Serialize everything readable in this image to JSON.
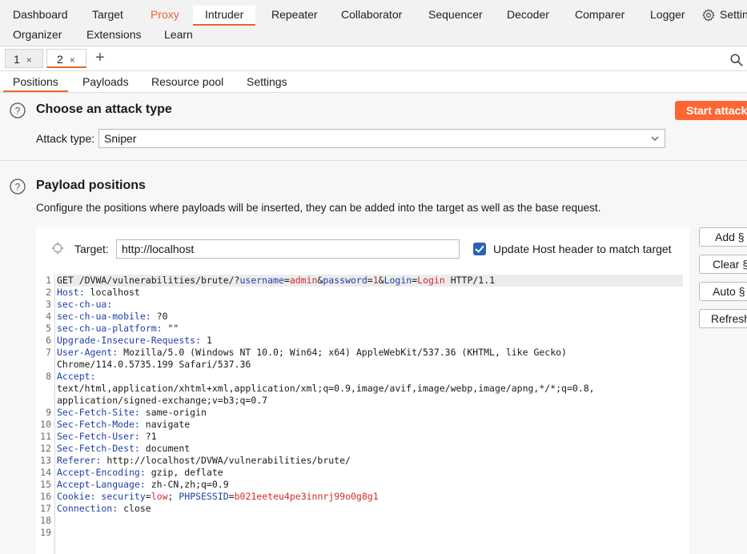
{
  "nav": {
    "items": [
      "Dashboard",
      "Target",
      "Proxy",
      "Intruder",
      "Repeater",
      "Collaborator",
      "Sequencer",
      "Decoder",
      "Comparer",
      "Logger",
      "Settings",
      "Organizer",
      "Extensions",
      "Learn"
    ],
    "settings_label": "Settings",
    "active": "Intruder"
  },
  "instance_tabs": [
    {
      "label": "1",
      "close": "×"
    },
    {
      "label": "2",
      "close": "×"
    }
  ],
  "new_tab": "+",
  "subtabs": [
    "Positions",
    "Payloads",
    "Resource pool",
    "Settings"
  ],
  "attack_section": {
    "title": "Choose an attack type",
    "start_label": "Start attack",
    "attack_type_label": "Attack type:",
    "attack_type_value": "Sniper"
  },
  "positions_section": {
    "title": "Payload positions",
    "description": "Configure the positions where payloads will be inserted, they can be added into the target as well as the base request.",
    "target_label": "Target:",
    "target_value": "http://localhost",
    "update_host_label": "Update Host header to match target",
    "update_host_checked": true
  },
  "side_buttons": [
    "Add §",
    "Clear §",
    "Auto §",
    "Refresh"
  ],
  "request": {
    "line_numbers": [
      "1",
      "2",
      "3",
      "4",
      "5",
      "6",
      "7",
      "",
      "8",
      "",
      "",
      "9",
      "10",
      "11",
      "12",
      "13",
      "14",
      "15",
      "16",
      "17",
      "18",
      "19"
    ],
    "l1": {
      "a": "GET /DVWA/vulnerabilities/brute/?",
      "k1": "username",
      "eq1": "=",
      "v1": "admin",
      "amp1": "&",
      "k2": "password",
      "eq2": "=",
      "v2": "1",
      "amp2": "&",
      "k3": "Login",
      "eq3": "=",
      "v3": "Login",
      "b": " HTTP/1.1"
    },
    "l2": {
      "k": "Host:",
      "v": " localhost"
    },
    "l3": {
      "k": "sec-ch-ua:",
      "v": ""
    },
    "l4": {
      "k": "sec-ch-ua-mobile:",
      "v": " ?0"
    },
    "l5": {
      "k": "sec-ch-ua-platform:",
      "v": " \"\""
    },
    "l6": {
      "k": "Upgrade-Insecure-Requests:",
      "v": " 1"
    },
    "l7": {
      "k": "User-Agent:",
      "v": " Mozilla/5.0 (Windows NT 10.0; Win64; x64) AppleWebKit/537.36 (KHTML, like Gecko)"
    },
    "l7b": "Chrome/114.0.5735.199 Safari/537.36",
    "l8": {
      "k": "Accept:",
      "v": ""
    },
    "l8b": "text/html,application/xhtml+xml,application/xml;q=0.9,image/avif,image/webp,image/apng,*/*;q=0.8,",
    "l8c": "application/signed-exchange;v=b3;q=0.7",
    "l9": {
      "k": "Sec-Fetch-Site:",
      "v": " same-origin"
    },
    "l10": {
      "k": "Sec-Fetch-Mode:",
      "v": " navigate"
    },
    "l11": {
      "k": "Sec-Fetch-User:",
      "v": " ?1"
    },
    "l12": {
      "k": "Sec-Fetch-Dest:",
      "v": " document"
    },
    "l13": {
      "k": "Referer:",
      "v": " http://localhost/DVWA/vulnerabilities/brute/"
    },
    "l14": {
      "k": "Accept-Encoding:",
      "v": " gzip, deflate"
    },
    "l15": {
      "k": "Accept-Language:",
      "v": " zh-CN,zh;q=0.9"
    },
    "l16": {
      "k": "Cookie:",
      "ck1": " security",
      "eq1": "=",
      "cv1": "low",
      "sep": "; ",
      "ck2": "PHPSESSID",
      "eq2": "=",
      "cv2": "b021eeteu4pe3innrj99o0g8g1"
    },
    "l17": {
      "k": "Connection:",
      "v": " close"
    }
  },
  "colors": {
    "accent": "#e8662b",
    "start_button": "#ff6633",
    "header_key": "#1f3fa6",
    "param_value": "#d12b2b",
    "checkbox": "#2b63b5"
  }
}
